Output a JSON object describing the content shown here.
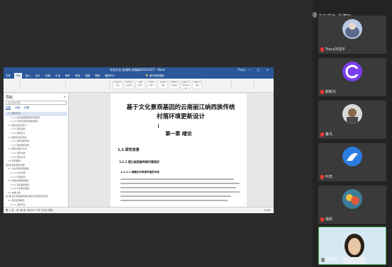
{
  "meeting": {
    "speaking_label": "正在讲话: 张清昭",
    "participants": [
      {
        "name": "Tracy刘清平",
        "mic": "muted",
        "avatar_color": "#5b6a8a"
      },
      {
        "name": "颜新元",
        "mic": "muted",
        "avatar_color": "#7a3ff0"
      },
      {
        "name": "秦凡",
        "mic": "muted",
        "avatar_color": "#d9d9d9"
      },
      {
        "name": "叶蕊",
        "mic": "muted",
        "avatar_color": "#2b7de0"
      },
      {
        "name": "徐彤",
        "mic": "muted",
        "avatar_color": "#3c7e9a"
      },
      {
        "name": "张清昭",
        "mic": "on",
        "avatar_color": "#cfe4f2"
      }
    ]
  },
  "word": {
    "title": "毕业论文-张清昭-终稿改20210427 - Word",
    "user": "Tracy",
    "window_controls": "─ □ ✕",
    "tabs": [
      "文件",
      "开始",
      "插入",
      "设计",
      "布局",
      "引用",
      "邮件",
      "审阅",
      "视图",
      "帮助",
      "福昕PDF"
    ],
    "search_label": "操作说明搜索",
    "styles": [
      {
        "preview": "AaBbCcI",
        "name": "正文"
      },
      {
        "preview": "AaBbCcI",
        "name": "无间隔"
      },
      {
        "preview": "AaBb",
        "name": "标题 1"
      },
      {
        "preview": "AaBbC",
        "name": "标题 2"
      },
      {
        "preview": "AaBbC",
        "name": "标题"
      },
      {
        "preview": "AaBbCcI",
        "name": "副标题"
      },
      {
        "preview": "AaBbCcI",
        "name": "不明显强调"
      },
      {
        "preview": "AaBbCcI",
        "name": "强调"
      }
    ],
    "nav": {
      "title": "导航",
      "close": "✕",
      "search_placeholder": "在文档中搜索",
      "tabs": [
        "标题",
        "页面",
        "结果"
      ],
      "items": [
        "1.1 研究背景",
        "1.1.1 丽江纳西族传统村落现状",
        "1.1.2 文化景观基因相关研究",
        "1.2 研究目的与意义",
        "1.2.1 研究目的",
        "1.2.2 研究意义",
        "1.3 国内外研究现状",
        "1.3.1 国外研究现状",
        "1.3.2 国内研究现状",
        "1.4 研究内容与方法",
        "1.4.1 研究内容",
        "1.4.2 研究方法",
        "1.5 研究框架",
        "第2章 相关理论基础",
        "2.1 文化景观基因理论",
        "2.1.1 文化景观",
        "2.1.2 景观基因",
        "2.2 传统村落更新理论",
        "2.2.1 有机更新理论",
        "2.2.2 乡村振兴理论",
        "2.3 本章小结",
        "第3章 丽江纳西族传统村落文化景观基因识别",
        "3.1 研究区域概况",
        "3.1.1 自然环境",
        "3.1.2 人文环境",
        "3.2 景观基因识别"
      ]
    },
    "page": {
      "title_line1": "基于文化景观基因的云南丽江纳西族传统",
      "title_line2": "村落环境更新设计",
      "chapter": "第一章  绪论",
      "h1": "1.1 研究背景",
      "h2": "1.1.1 丽江纳西族传统村落现状",
      "h3": "1.1.1.1 城镇化对传统村落的冲击"
    },
    "status": {
      "left": "第 1 页，共 66 页   36245 个字   中文(中国)",
      "right": "110%"
    }
  }
}
